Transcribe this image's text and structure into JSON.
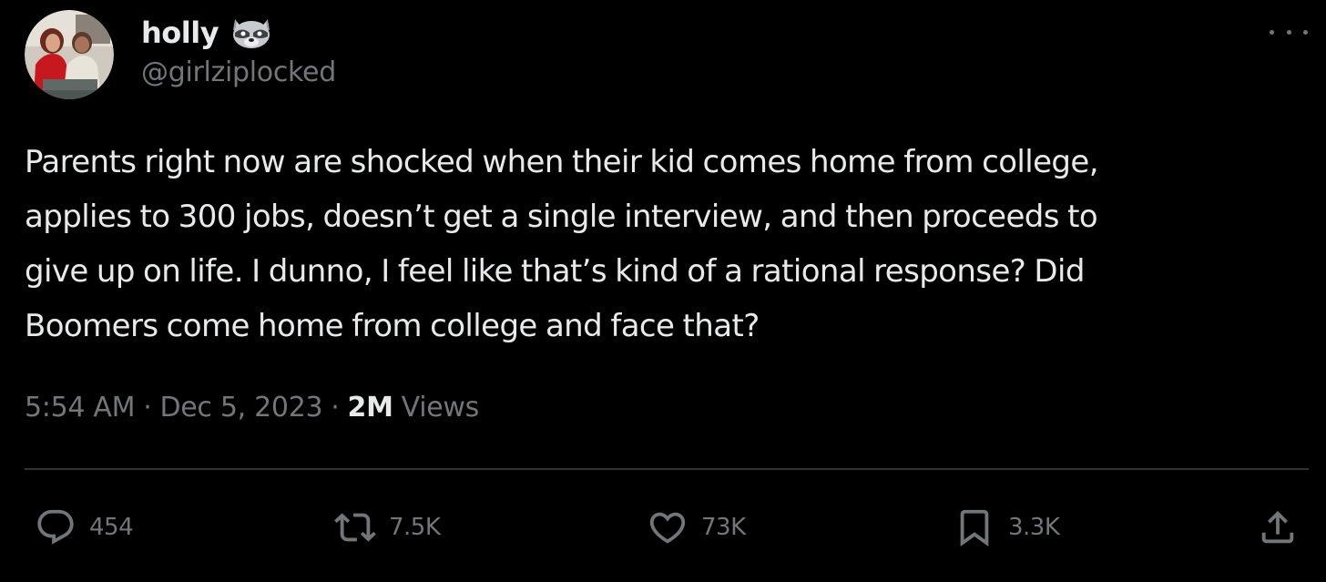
{
  "tweet": {
    "author": {
      "display_name": "holly",
      "emoji": "raccoon-emoji",
      "handle": "@girlziplocked"
    },
    "text_lines": [
      "Parents right now are shocked when their kid comes home from college,",
      "applies to 300 jobs, doesn’t get a single interview, and then proceeds to",
      "give up on life. I dunno, I feel like that’s kind of a rational response? Did",
      "Boomers come home from college and face that?"
    ],
    "meta": {
      "time": "5:54 AM",
      "separator": "·",
      "date": "Dec 5, 2023",
      "views_count": "2M",
      "views_label": "Views"
    },
    "actions": {
      "replies": "454",
      "retweets": "7.5K",
      "likes": "73K",
      "bookmarks": "3.3K"
    }
  },
  "icons": {
    "more": "more-horizontal-icon",
    "reply": "reply-bubble-icon",
    "retweet": "retweet-icon",
    "like": "heart-icon",
    "bookmark": "bookmark-icon",
    "share": "share-upload-icon"
  },
  "colors": {
    "background": "#000000",
    "primary_text": "#e7e9ea",
    "secondary_text": "#71767b",
    "divider": "#2f3336"
  }
}
